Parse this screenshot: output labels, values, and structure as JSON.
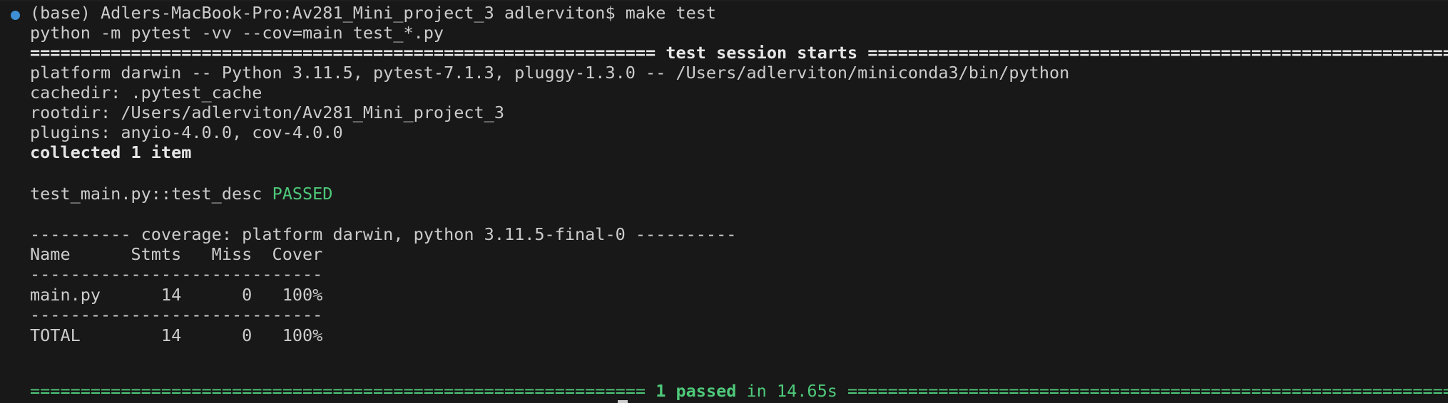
{
  "terminal": {
    "prompt_command": "(base) Adlers-MacBook-Pro:Av281_Mini_project_3 adlerviton$ make test",
    "echo_command": "python -m pytest -vv --cov=main test_*.py",
    "session_separator_left": "============================================================== ",
    "session_title": "test session starts",
    "session_separator_right": " ==============================================================",
    "platform_line": "platform darwin -- Python 3.11.5, pytest-7.1.3, pluggy-1.3.0 -- /Users/adlerviton/miniconda3/bin/python",
    "cachedir_line": "cachedir: .pytest_cache",
    "rootdir_line": "rootdir: /Users/adlerviton/Av281_Mini_project_3",
    "plugins_line": "plugins: anyio-4.0.0, cov-4.0.0",
    "collected_line": "collected 1 item",
    "test_name": "test_main.py::test_desc ",
    "test_status": "PASSED",
    "coverage_header": "---------- coverage: platform darwin, python 3.11.5-final-0 ----------",
    "coverage_columns": "Name      Stmts   Miss  Cover",
    "coverage_rule_1": "-----------------------------",
    "coverage_row_main": "main.py      14      0   100%",
    "coverage_rule_2": "-----------------------------",
    "coverage_row_total": "TOTAL        14      0   100%",
    "summary_separator_left": "============================================================= ",
    "summary_passed": "1 passed",
    "summary_time": " in 14.65s",
    "summary_separator_right": " =============================================================="
  },
  "colors": {
    "background": "#181818",
    "text": "#cccccc",
    "pass_green": "#4ec97a",
    "prompt_marker_blue": "#3d8fd6"
  }
}
